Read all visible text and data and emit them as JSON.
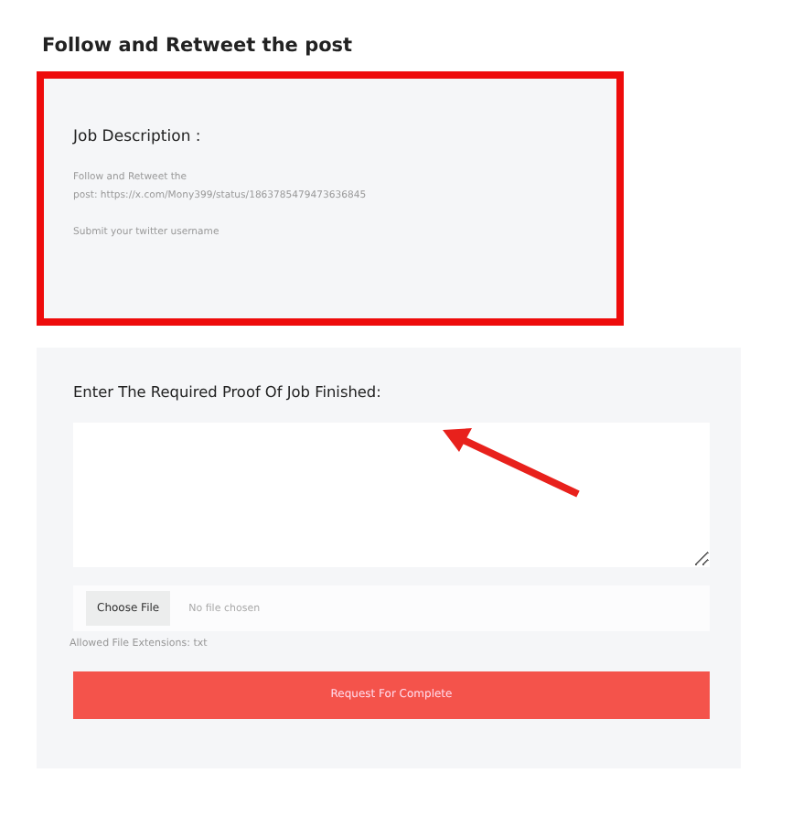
{
  "page_title": "Follow and Retweet the post",
  "job_card": {
    "highlighted": true,
    "heading": "Job Description :",
    "lines": [
      "Follow and Retweet the",
      "post: https://x.com/Mony399/status/1863785479473636845"
    ],
    "note": "Submit your twitter username"
  },
  "proof_form": {
    "label": "Enter The Required Proof Of Job Finished:",
    "file_button": "Choose File",
    "file_status": "No file chosen",
    "hint": "Allowed File Extensions: txt",
    "submit": "Request For Complete"
  }
}
